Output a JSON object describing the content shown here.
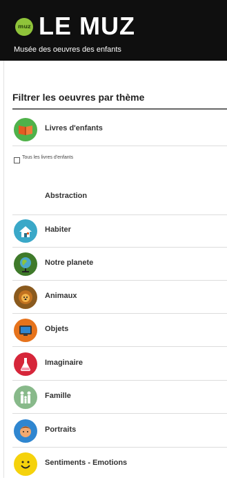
{
  "header": {
    "brand": "LE MUZ",
    "logo_badge": "muz",
    "subtitle": "Musée des oeuvres des enfants",
    "background": "#0f0f0f",
    "logo_color": "#8fc33a"
  },
  "filter": {
    "title": "Filtrer les oeuvres par thème",
    "selected_category": {
      "label": "Livres d'enfants",
      "icon": "book-icon",
      "color": "#4fb24a"
    },
    "checkbox_label": "Tous les livres d'enfants",
    "checkbox_checked": false,
    "first_item": "Abstraction",
    "themes": [
      {
        "label": "Habiter",
        "icon": "house-icon",
        "color": "#3aa8c8"
      },
      {
        "label": "Notre planete",
        "icon": "globe-icon",
        "color": "#3f7a2a"
      },
      {
        "label": "Animaux",
        "icon": "lion-icon",
        "color": "#8a5a1e"
      },
      {
        "label": "Objets",
        "icon": "tv-icon",
        "color": "#e6731c"
      },
      {
        "label": "Imaginaire",
        "icon": "flask-icon",
        "color": "#d6263a"
      },
      {
        "label": "Famille",
        "icon": "family-icon",
        "color": "#88b98a"
      },
      {
        "label": "Portraits",
        "icon": "face-icon",
        "color": "#2f86d0"
      },
      {
        "label": "Sentiments - Emotions",
        "icon": "smiley-icon",
        "color": "#f5d20c"
      }
    ]
  }
}
